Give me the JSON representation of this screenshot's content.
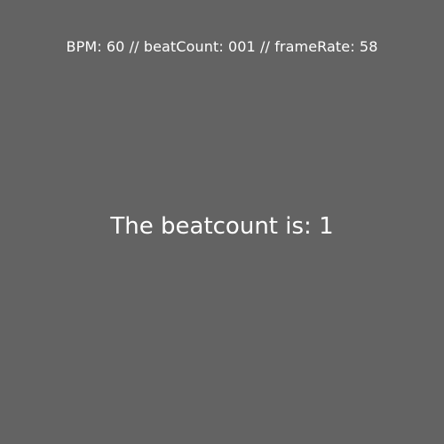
{
  "app": {
    "status": {
      "bpm_label": "BPM: ",
      "bpm_value": "60",
      "separator_1": " // ",
      "beatcount_label": "beatCount: ",
      "beatcount_value": "001",
      "separator_2": " // ",
      "framerate_label": "frameRate: ",
      "framerate_value": "58"
    },
    "message": {
      "prefix": "The beatcount is: ",
      "value": "1"
    }
  },
  "colors": {
    "background": "#636363",
    "text": "#ffffff"
  }
}
